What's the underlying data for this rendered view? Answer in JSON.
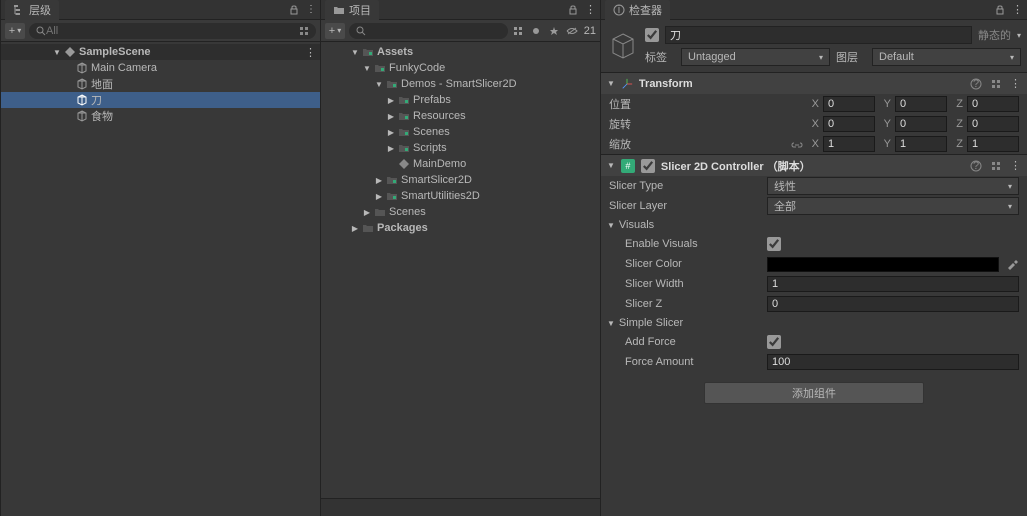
{
  "hierarchy": {
    "title": "层级",
    "search_placeholder": "All",
    "scene": "SampleScene",
    "items": [
      "Main Camera",
      "地面",
      "刀",
      "食物"
    ],
    "selected": "刀"
  },
  "project": {
    "title": "项目",
    "visibility_count": "21",
    "root": "Assets",
    "tree": {
      "funkycode": "FunkyCode",
      "demos": "Demos - SmartSlicer2D",
      "prefabs": "Prefabs",
      "resources": "Resources",
      "scenes_inner": "Scenes",
      "scripts": "Scripts",
      "maindemo": "MainDemo",
      "smartslicer": "SmartSlicer2D",
      "smartutil": "SmartUtilities2D",
      "scenes": "Scenes",
      "packages": "Packages"
    }
  },
  "inspector": {
    "title": "检查器",
    "object_name": "刀",
    "static_label": "静态的",
    "tag_label": "标签",
    "tag_value": "Untagged",
    "layer_label": "图层",
    "layer_value": "Default",
    "transform": {
      "title": "Transform",
      "position": "位置",
      "rotation": "旋转",
      "scale": "缩放",
      "pos": {
        "x": "0",
        "y": "0",
        "z": "0"
      },
      "rot": {
        "x": "0",
        "y": "0",
        "z": "0"
      },
      "scl": {
        "x": "1",
        "y": "1",
        "z": "1"
      }
    },
    "slicer": {
      "title": "Slicer 2D Controller （脚本）",
      "type_label": "Slicer Type",
      "type_value": "线性",
      "layer_label": "Slicer Layer",
      "layer_value": "全部",
      "visuals_label": "Visuals",
      "enable_visuals": "Enable Visuals",
      "slicer_color": "Slicer Color",
      "slicer_width": "Slicer Width",
      "slicer_width_v": "1",
      "slicer_z": "Slicer Z",
      "slicer_z_v": "0",
      "simple_label": "Simple Slicer",
      "add_force": "Add Force",
      "force_amount": "Force Amount",
      "force_amount_v": "100"
    },
    "add_component": "添加组件"
  }
}
